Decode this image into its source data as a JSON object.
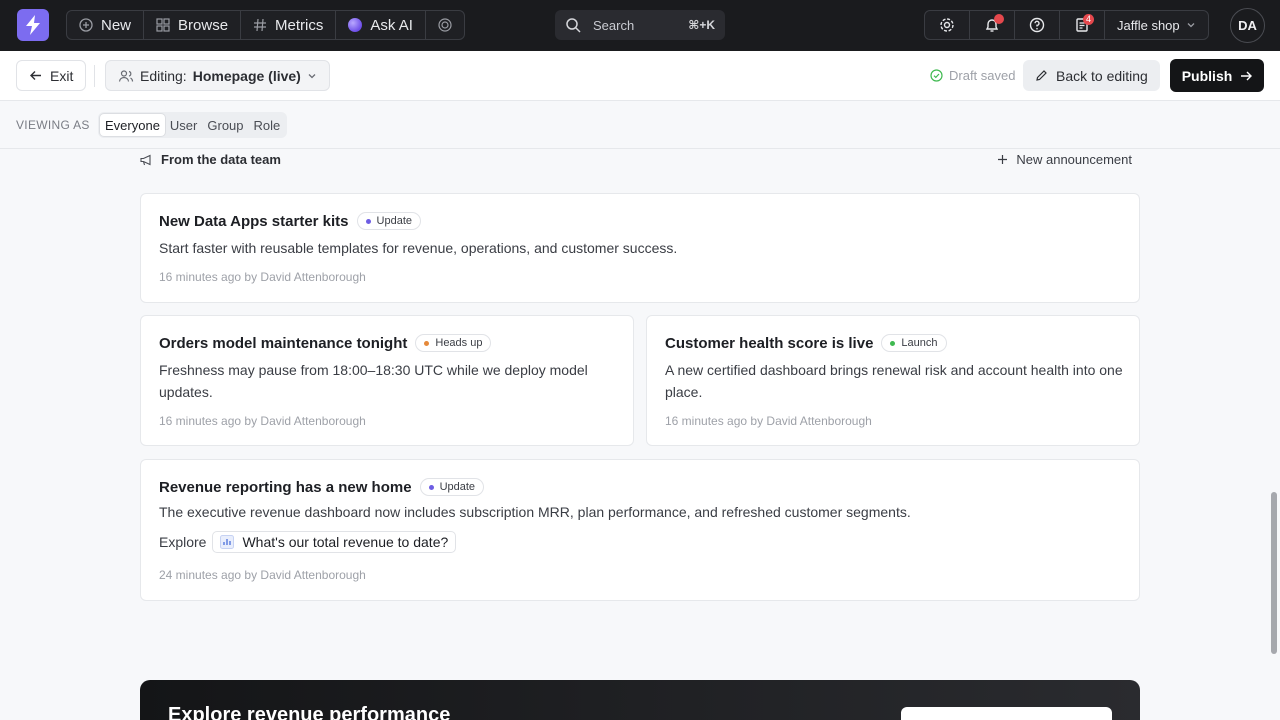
{
  "colors": {
    "accent": "#7c6cf0",
    "update_dot": "#6d5de3",
    "headsup_dot": "#e5893a",
    "launch_dot": "#3fb950"
  },
  "topnav": {
    "new_label": "New",
    "browse_label": "Browse",
    "metrics_label": "Metrics",
    "askai_label": "Ask AI",
    "search_label": "Search",
    "search_shortcut": "⌘+K",
    "notifications_count": "4",
    "workspace_label": "Jaffle shop",
    "avatar_initials": "DA"
  },
  "editbar": {
    "exit_label": "Exit",
    "editing_prefix": "Editing:",
    "editing_target": "Homepage (live)",
    "draft_status": "Draft saved",
    "back_label": "Back to editing",
    "publish_label": "Publish"
  },
  "viewing": {
    "label": "VIEWING AS",
    "options": [
      "Everyone",
      "User",
      "Group",
      "Role"
    ],
    "selected": "Everyone"
  },
  "section": {
    "title": "From the data team",
    "new_label": "New announcement"
  },
  "announcements": [
    {
      "title": "New Data Apps starter kits",
      "tag": "Update",
      "body": "Start faster with reusable templates for revenue, operations, and customer success.",
      "meta": "16 minutes ago by David Attenborough"
    },
    {
      "title": "Orders model maintenance tonight",
      "tag": "Heads up",
      "body": "Freshness may pause from 18:00–18:30 UTC while we deploy model updates.",
      "meta": "16 minutes ago by David Attenborough"
    },
    {
      "title": "Customer health score is live",
      "tag": "Launch",
      "body": "A new certified dashboard brings renewal risk and account health into one place.",
      "meta": "16 minutes ago by David Attenborough"
    },
    {
      "title": "Revenue reporting has a new home",
      "tag": "Update",
      "body": "The executive revenue dashboard now includes subscription MRR, plan performance, and refreshed customer segments.",
      "explore_label": "Explore",
      "question": "What's our total revenue to date?",
      "meta": "24 minutes ago by David Attenborough"
    }
  ],
  "hero": {
    "title": "Explore revenue performance"
  }
}
